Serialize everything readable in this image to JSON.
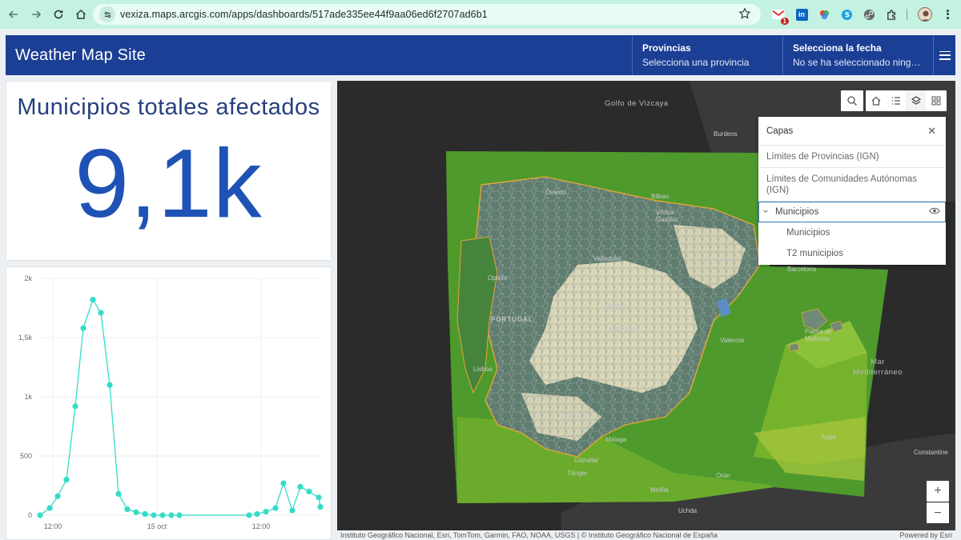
{
  "browser": {
    "url": "vexiza.maps.arcgis.com/apps/dashboards/517ade335ee44f9aa06ed6f2707ad6b1",
    "gmail_badge": "1",
    "linkedin_glyph": "in"
  },
  "header": {
    "title": "Weather Map Site",
    "provinces_label": "Provincias",
    "provinces_value": "Selecciona una provincia",
    "date_label": "Selecciona la fecha",
    "date_value": "No se ha seleccionado ningun..."
  },
  "indicator": {
    "title": "Municipios totales afectados",
    "value": "9,1k"
  },
  "chart_data": {
    "type": "line",
    "y_ticks": [
      "0",
      "500",
      "1k",
      "1,5k",
      "2k"
    ],
    "x_ticks": [
      "12:00",
      "15 oct",
      "12:00"
    ],
    "ylim": [
      0,
      2000
    ],
    "series": [
      {
        "values": [
          0,
          60,
          160,
          300,
          920,
          1580,
          1820,
          1710,
          1100,
          180,
          50,
          25,
          10,
          0,
          0,
          0,
          0,
          0,
          10,
          30,
          60,
          270,
          40,
          240,
          200,
          150,
          70
        ]
      }
    ],
    "color": "#35dcc8"
  },
  "map": {
    "layers_panel_title": "Capas",
    "layers": [
      "Límites de Provincias (IGN)",
      "Límites de Comunidades Autónomas (IGN)",
      "Municipios"
    ],
    "sublayers": [
      "Municipios",
      "T2 municipios"
    ],
    "labels": {
      "golfo": "Golfo de Vizcaya",
      "mar": "Mar Mediterráneo",
      "burdeos": "Burdeos",
      "oviedo": "Oviedo",
      "bilbao": "Bilbao",
      "vitoria": "Vitoria-Gasteiz",
      "valladolid": "Valladolid",
      "zaragoza": "Zaragoza",
      "oporto": "Oporto",
      "barcelona": "Barcelona",
      "portugal": "PORTUGAL",
      "madrid": "Madrid",
      "espana": "ESPAÑA",
      "palma": "Palma de Mallorca",
      "valencia": "Valencia",
      "lisboa": "Lisboa",
      "sevilla": "Sevilla",
      "malaga": "Málaga",
      "gibraltar": "Gibraltar",
      "argel": "Argel",
      "tanger": "Tánger",
      "oran": "Orán",
      "melilla": "Melilla",
      "uchda": "Uchda",
      "constantine": "Constantine"
    },
    "attribution": "Instituto Geográfico Nacional, Esri, TomTom, Garmin, FAO, NOAA, USGS | © Instituto Geográfico Nacional de España",
    "powered_by": "Powered by Esri",
    "colors": {
      "raster_green": "#4e9a2c",
      "municipality_gray": "#5f7d70",
      "municipality_cream": "#e6e0c0",
      "boundary_orange": "#e3a63c",
      "dark_basemap": "#2b2b2b"
    }
  }
}
